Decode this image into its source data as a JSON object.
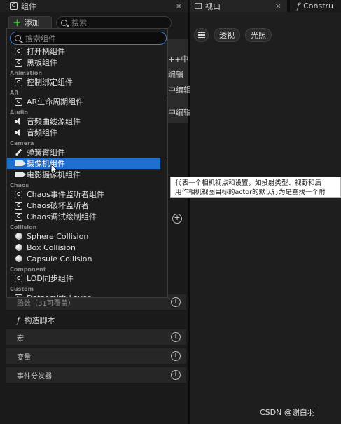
{
  "tabs": {
    "components_tab": "组件",
    "viewport_tab": "视口",
    "construct_tab": "Constru"
  },
  "toolbar": {
    "add_label": "添加",
    "search_placeholder": "搜索"
  },
  "background": {
    "line1": "++中",
    "line2": "编辑",
    "line3": "中编辑",
    "line4": "中编辑",
    "construct_script": "构造脚本",
    "sections": [
      "宏",
      "变量",
      "事件分发器"
    ],
    "partial_section": "函数（31可覆盖）"
  },
  "dropdown": {
    "search_placeholder": "搜索组件",
    "rows": [
      {
        "kind": "item",
        "icon": "component-icon",
        "label": "打开柄组件"
      },
      {
        "kind": "item",
        "icon": "component-icon",
        "label": "黑板组件"
      },
      {
        "kind": "category",
        "label": "Animation"
      },
      {
        "kind": "item",
        "icon": "component-icon",
        "label": "控制绑定组件"
      },
      {
        "kind": "category",
        "label": "AR"
      },
      {
        "kind": "item",
        "icon": "component-icon",
        "label": "AR生命周期组件"
      },
      {
        "kind": "category",
        "label": "Audio"
      },
      {
        "kind": "item",
        "icon": "sound-icon",
        "label": "音频曲线源组件"
      },
      {
        "kind": "item",
        "icon": "sound-icon",
        "label": "音频组件"
      },
      {
        "kind": "category",
        "label": "Camera"
      },
      {
        "kind": "item",
        "icon": "spring-arm-icon",
        "label": "弹簧臂组件"
      },
      {
        "kind": "item",
        "icon": "camera-icon",
        "label": "摄像机组件",
        "selected": true
      },
      {
        "kind": "item",
        "icon": "camera-icon",
        "label": "电影摄像机组件"
      },
      {
        "kind": "category",
        "label": "Chaos"
      },
      {
        "kind": "item",
        "icon": "component-icon",
        "label": "Chaos事件监听者组件"
      },
      {
        "kind": "item",
        "icon": "component-icon",
        "label": "Chaos破坏监听者"
      },
      {
        "kind": "item",
        "icon": "component-icon",
        "label": "Chaos调试绘制组件"
      },
      {
        "kind": "category",
        "label": "Collision"
      },
      {
        "kind": "item",
        "icon": "collision-icon",
        "label": "Sphere Collision"
      },
      {
        "kind": "item",
        "icon": "collision-icon",
        "label": "Box Collision"
      },
      {
        "kind": "item",
        "icon": "collision-icon",
        "label": "Capsule Collision"
      },
      {
        "kind": "category",
        "label": "Component"
      },
      {
        "kind": "item",
        "icon": "component-icon",
        "label": "LOD同步组件"
      },
      {
        "kind": "category",
        "label": "Custom"
      },
      {
        "kind": "item",
        "icon": "component-icon",
        "label": "Datasmith Layer"
      }
    ]
  },
  "viewport": {
    "perspective_label": "透视",
    "lighting_label": "光照"
  },
  "tooltip": {
    "line1": "代表一个相机视点和设置，如投射类型、视野和后",
    "line2": "用作相机视图目标的actor的默认行为是查找一个附"
  },
  "watermark": "CSDN @谢白羽"
}
